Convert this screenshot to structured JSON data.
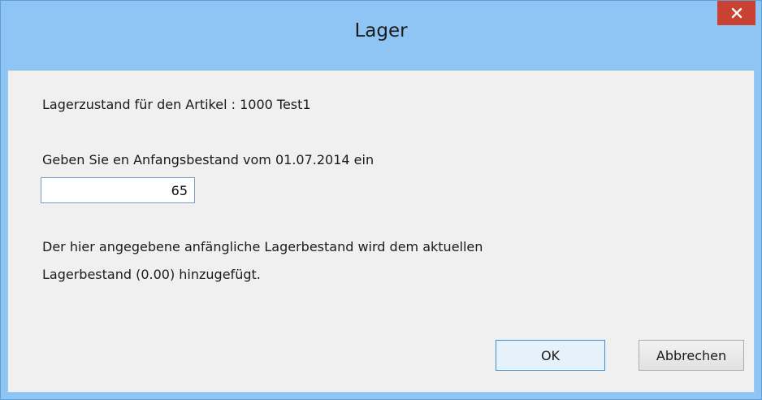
{
  "window": {
    "title": "Lager",
    "close_icon": "close-icon"
  },
  "dialog": {
    "article_label": "Lagerzustand für den Artikel : 1000 Test1",
    "prompt_label": "Geben Sie en Anfangsbestand vom 01.07.2014 ein",
    "quantity_value": "65",
    "info_line1": "Der hier angegebene anfängliche Lagerbestand wird dem aktuellen",
    "info_line2": "Lagerbestand (0.00) hinzugefügt."
  },
  "buttons": {
    "ok_label": "OK",
    "cancel_label": "Abbrechen"
  },
  "colors": {
    "titlebar": "#8ec5f5",
    "close_button": "#c84131",
    "client_background": "#f0f0f0",
    "focus_border": "#3c8fd6"
  }
}
